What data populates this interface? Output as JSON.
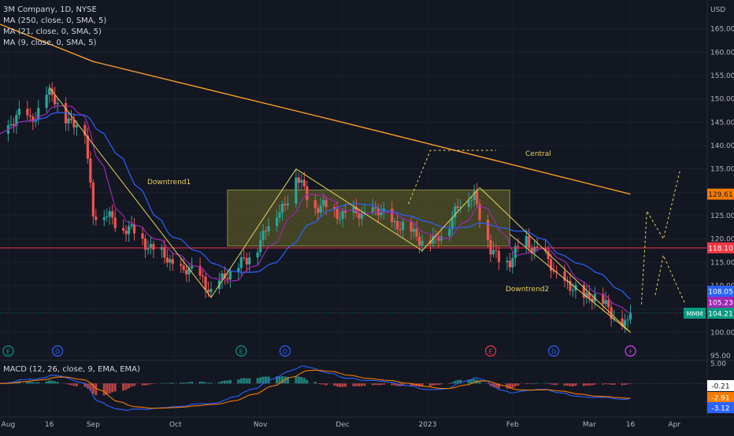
{
  "header": {
    "symbol_line": "3M Company, 1D, NYSE",
    "ma_lines": [
      "MA (250, close, 0, SMA, 5)",
      "MA (21, close, 0, SMA, 5)",
      "MA (9, close, 0, SMA, 5)"
    ],
    "currency": "USD"
  },
  "macd": {
    "legend": "MACD (12, 26, close, 9, EMA, EMA)",
    "scale_top": "5.00",
    "labels": [
      {
        "text": "-0.21",
        "bg": "#ffffff",
        "fg": "#131722"
      },
      {
        "text": "-2.91",
        "bg": "#f57c00",
        "fg": "#ffffff"
      },
      {
        "text": "-3.12",
        "bg": "#2962ff",
        "fg": "#ffffff"
      }
    ]
  },
  "price_tags": [
    {
      "value": 129.61,
      "text": "129.61",
      "bg": "#f57c00",
      "fg": "#131722"
    },
    {
      "value": 118.1,
      "text": "118.10",
      "bg": "#f23645",
      "fg": "#ffffff"
    },
    {
      "value": 108.05,
      "text": "108.05",
      "bg": "#2962ff",
      "fg": "#ffffff"
    },
    {
      "value": 105.23,
      "text": "105.23",
      "bg": "#9c27b0",
      "fg": "#ffffff"
    },
    {
      "value": 104.21,
      "text": "104.21",
      "bg": "#089981",
      "fg": "#ffffff"
    }
  ],
  "ticker_badge": "MMM",
  "annotations": {
    "downtrend1": "Downtrend1",
    "downtrend2": "Downtrend2",
    "central": "Central"
  },
  "event_markers": [
    {
      "label": "E",
      "color": "#089981",
      "x": "2022-08-01"
    },
    {
      "label": "D",
      "color": "#2962ff",
      "x": "2022-08-19"
    },
    {
      "label": "E",
      "color": "#089981",
      "x": "2022-10-25"
    },
    {
      "label": "D",
      "color": "#2962ff",
      "x": "2022-11-10"
    },
    {
      "label": "E",
      "color": "#f23645",
      "x": "2023-01-24"
    },
    {
      "label": "D",
      "color": "#2962ff",
      "x": "2023-02-16"
    },
    {
      "label": "⚡",
      "color": "#e040fb",
      "x": "2023-03-16"
    }
  ],
  "colors": {
    "up": "#26a69a",
    "down": "#ef5350",
    "ma250": "#f59d2a",
    "ma21": "#2962ff",
    "ma9": "#9c27b0",
    "trend": "#e6d35a",
    "zone_fill": "#6b6a2a",
    "hline": "#f23645",
    "macd_line": "#2962ff",
    "signal_line": "#f57c00"
  },
  "chart_data": {
    "type": "candlestick",
    "title": "3M Company, 1D, NYSE",
    "xlabel": "",
    "ylabel": "USD",
    "ylim": [
      95,
      170
    ],
    "xlim": [
      "2022-07-29",
      "2023-04-13"
    ],
    "y_ticks": [
      95,
      100,
      105,
      110,
      115,
      120,
      125,
      130,
      135,
      140,
      145,
      150,
      155,
      160,
      165
    ],
    "x_ticks": [
      {
        "label": "Aug",
        "x": "2022-08-01"
      },
      {
        "label": "16",
        "x": "2022-08-16"
      },
      {
        "label": "Sep",
        "x": "2022-09-01"
      },
      {
        "label": "Oct",
        "x": "2022-10-01"
      },
      {
        "label": "Nov",
        "x": "2022-11-01"
      },
      {
        "label": "Dec",
        "x": "2022-12-01"
      },
      {
        "label": "2023",
        "x": "2023-01-01"
      },
      {
        "label": "Feb",
        "x": "2023-02-01"
      },
      {
        "label": "Mar",
        "x": "2023-03-01"
      },
      {
        "label": "16",
        "x": "2023-03-16"
      },
      {
        "label": "Apr",
        "x": "2023-04-01"
      }
    ],
    "anchor_closes": [
      [
        "2022-07-29",
        141
      ],
      [
        "2022-08-04",
        147
      ],
      [
        "2022-08-09",
        145
      ],
      [
        "2022-08-15",
        151
      ],
      [
        "2022-08-17",
        150
      ],
      [
        "2022-08-24",
        145
      ],
      [
        "2022-08-29",
        143
      ],
      [
        "2022-09-01",
        126
      ],
      [
        "2022-09-08",
        124
      ],
      [
        "2022-09-14",
        122
      ],
      [
        "2022-09-21",
        119
      ],
      [
        "2022-09-27",
        116
      ],
      [
        "2022-10-04",
        113
      ],
      [
        "2022-10-11",
        112
      ],
      [
        "2022-10-14",
        108
      ],
      [
        "2022-10-20",
        113
      ],
      [
        "2022-10-27",
        115
      ],
      [
        "2022-11-03",
        122
      ],
      [
        "2022-11-10",
        128
      ],
      [
        "2022-11-14",
        133
      ],
      [
        "2022-11-21",
        127
      ],
      [
        "2022-11-28",
        126
      ],
      [
        "2022-12-05",
        125
      ],
      [
        "2022-12-12",
        126
      ],
      [
        "2022-12-19",
        124
      ],
      [
        "2022-12-27",
        121
      ],
      [
        "2023-01-04",
        119
      ],
      [
        "2023-01-11",
        126
      ],
      [
        "2023-01-18",
        130
      ],
      [
        "2023-01-24",
        117
      ],
      [
        "2023-01-31",
        115
      ],
      [
        "2023-02-06",
        120
      ],
      [
        "2023-02-14",
        115
      ],
      [
        "2023-02-22",
        109
      ],
      [
        "2023-03-01",
        108
      ],
      [
        "2023-03-07",
        106
      ],
      [
        "2023-03-13",
        102
      ],
      [
        "2023-03-15",
        101
      ],
      [
        "2023-03-16",
        104.21
      ]
    ],
    "ma250": [
      [
        "2022-07-29",
        166
      ],
      [
        "2022-09-01",
        158
      ],
      [
        "2022-12-01",
        145
      ],
      [
        "2023-03-16",
        129.61
      ]
    ],
    "horizontal_lines": [
      {
        "y": 118.1
      },
      {
        "y": 104.21
      }
    ],
    "zone": {
      "x1": "2022-10-20",
      "x2": "2023-01-31",
      "y1": 118.5,
      "y2": 130.5
    },
    "trendlines": [
      {
        "from": [
          "2022-08-16",
          152.5
        ],
        "to": [
          "2022-10-14",
          107.5
        ]
      },
      {
        "from": [
          "2022-10-14",
          107.5
        ],
        "to": [
          "2022-11-14",
          135
        ]
      },
      {
        "from": [
          "2022-11-14",
          135
        ],
        "to": [
          "2022-12-30",
          117.5
        ]
      },
      {
        "from": [
          "2022-12-30",
          117.5
        ],
        "to": [
          "2023-01-20",
          131
        ]
      },
      {
        "from": [
          "2023-01-20",
          131
        ],
        "to": [
          "2023-03-16",
          100
        ]
      },
      {
        "from": [
          "2023-01-31",
          121
        ],
        "to": [
          "2023-03-16",
          100
        ]
      }
    ],
    "projection_paths": [
      [
        [
          "2023-03-20",
          106
        ],
        [
          "2023-03-22",
          126
        ],
        [
          "2023-03-28",
          120
        ],
        [
          "2023-04-03",
          134.5
        ]
      ],
      [
        [
          "2023-03-25",
          108
        ],
        [
          "2023-03-28",
          116.5
        ],
        [
          "2023-04-05",
          106
        ]
      ]
    ],
    "central_arrow": [
      [
        "2022-12-25",
        127.5
      ],
      [
        "2023-01-02",
        139
      ],
      [
        "2023-01-26",
        139
      ]
    ],
    "macd": {
      "ylim": [
        -6,
        5
      ],
      "macd_last": -3.12,
      "signal_last": -2.91,
      "hist_last": -0.21
    }
  }
}
